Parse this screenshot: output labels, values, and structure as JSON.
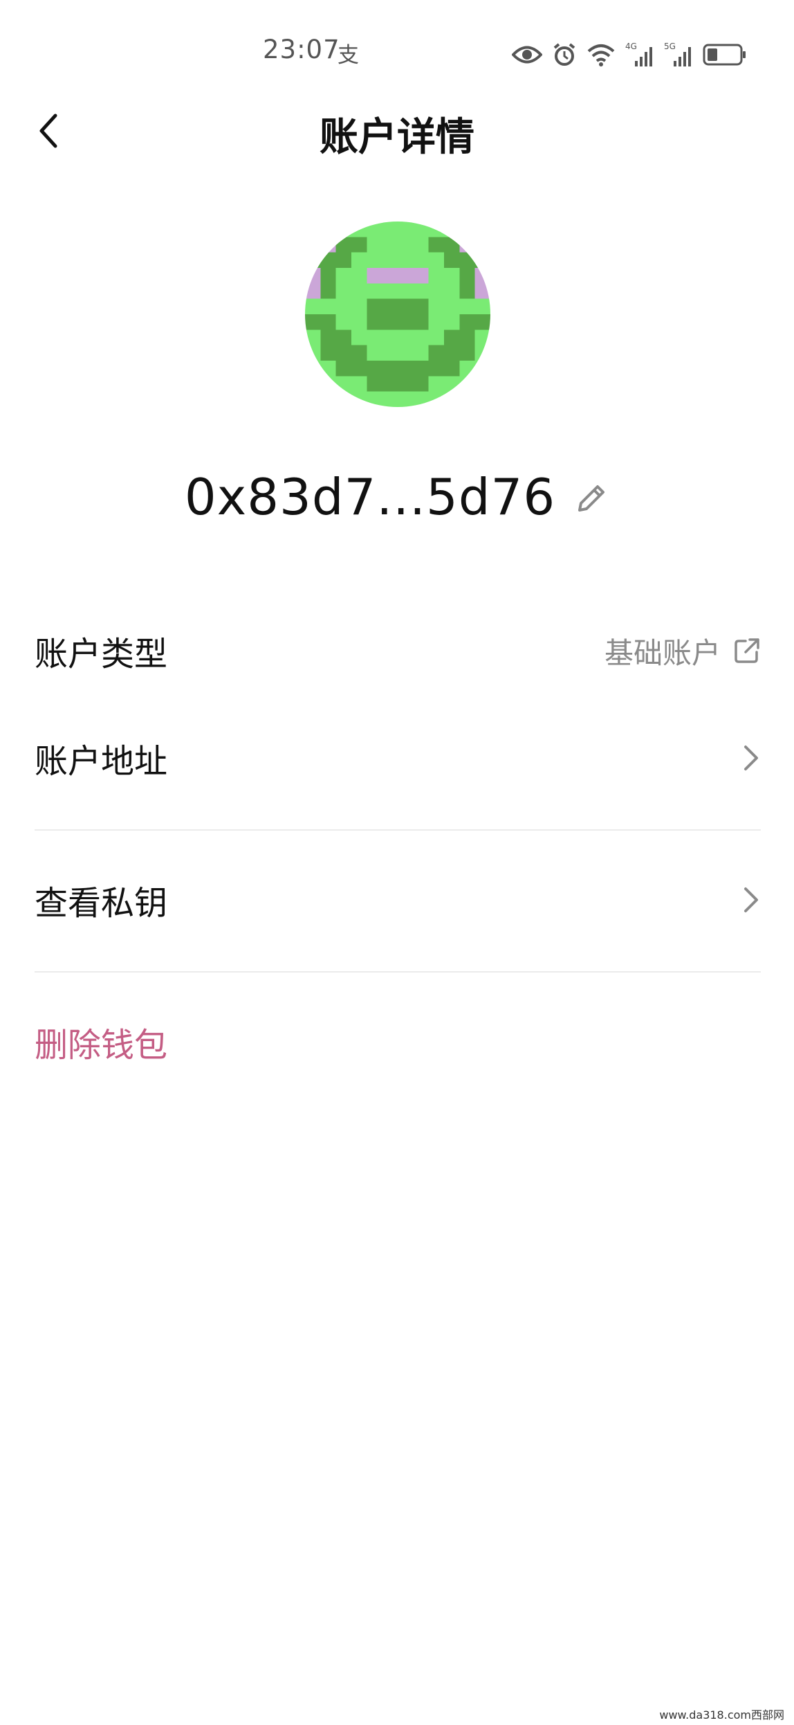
{
  "status_bar": {
    "time": "23:07",
    "extra_glyph": "支",
    "icons": [
      "eye-icon",
      "alarm-icon",
      "wifi-icon",
      "signal-4g-icon",
      "signal-5g-icon",
      "battery-icon"
    ],
    "network_labels": {
      "sim1": "4G",
      "sim2": "5G"
    }
  },
  "header": {
    "title": "账户详情",
    "back_icon": "chevron-left-icon"
  },
  "avatar": {
    "colors": {
      "light_green": "#7aeb74",
      "dark_green": "#56a846",
      "purple": "#cba6d8"
    }
  },
  "account": {
    "address_short": "0x83d7...5d76",
    "edit_icon": "pencil-icon"
  },
  "rows": [
    {
      "label": "账户类型",
      "value": "基础账户",
      "icon": "external-link-icon"
    },
    {
      "label": "账户地址",
      "icon": "chevron-right-icon"
    },
    {
      "label": "查看私钥",
      "icon": "chevron-right-icon"
    },
    {
      "label": "删除钱包",
      "color": "#c45d84"
    }
  ],
  "watermark": "www.da318.com西部网"
}
